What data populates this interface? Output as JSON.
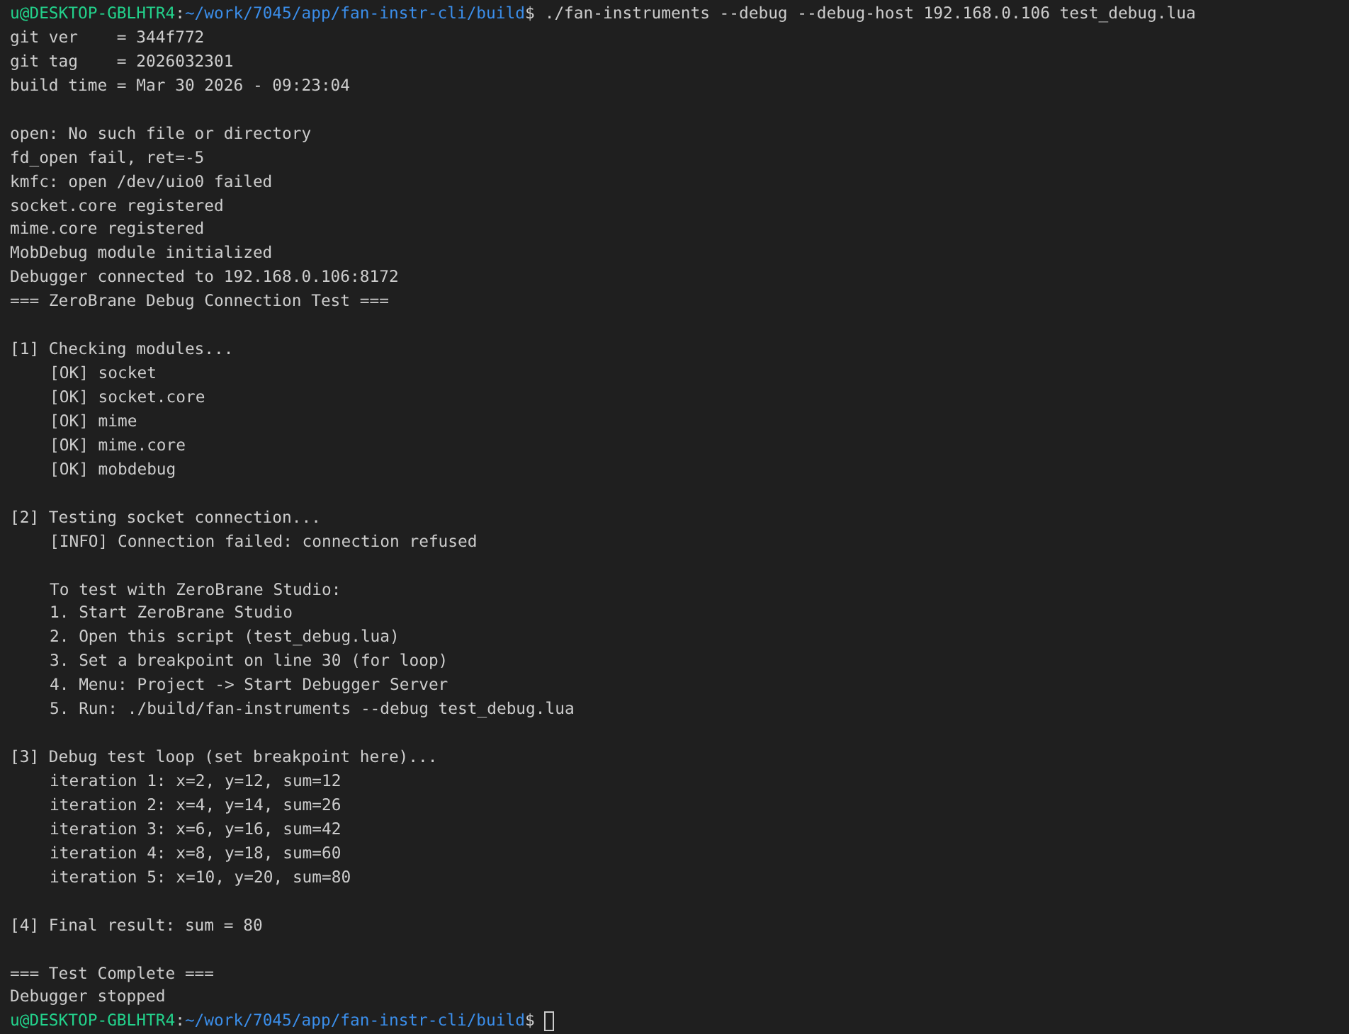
{
  "terminal": {
    "lines": [
      {
        "kind": "prompt",
        "user_host": "u@DESKTOP-GBLHTR4",
        "separator": ":",
        "path": "~/work/7045/app/fan-instr-cli/build",
        "symbol": "$",
        "command": "./fan-instruments --debug --debug-host 192.168.0.106 test_debug.lua",
        "cursor": false
      },
      {
        "kind": "output",
        "text": "git ver    = 344f772"
      },
      {
        "kind": "output",
        "text": "git tag    = 2026032301"
      },
      {
        "kind": "output",
        "text": "build time = Mar 30 2026 - 09:23:04"
      },
      {
        "kind": "blank"
      },
      {
        "kind": "output",
        "text": "open: No such file or directory"
      },
      {
        "kind": "output",
        "text": "fd_open fail, ret=-5"
      },
      {
        "kind": "output",
        "text": "kmfc: open /dev/uio0 failed"
      },
      {
        "kind": "output",
        "text": "socket.core registered"
      },
      {
        "kind": "output",
        "text": "mime.core registered"
      },
      {
        "kind": "output",
        "text": "MobDebug module initialized"
      },
      {
        "kind": "output",
        "text": "Debugger connected to 192.168.0.106:8172"
      },
      {
        "kind": "output",
        "text": "=== ZeroBrane Debug Connection Test ==="
      },
      {
        "kind": "blank"
      },
      {
        "kind": "output",
        "text": "[1] Checking modules...",
        "children": [
          {
            "kind": "output",
            "text": "[OK] socket"
          },
          {
            "kind": "output",
            "text": "[OK] socket.core"
          },
          {
            "kind": "output",
            "text": "[OK] mime"
          },
          {
            "kind": "output",
            "text": "[OK] mime.core"
          },
          {
            "kind": "output",
            "text": "[OK] mobdebug"
          }
        ]
      },
      {
        "kind": "blank"
      },
      {
        "kind": "output",
        "text": "[2] Testing socket connection...",
        "children": [
          {
            "kind": "output",
            "text": "[INFO] Connection failed: connection refused"
          },
          {
            "kind": "blank"
          },
          {
            "kind": "output",
            "text": "To test with ZeroBrane Studio:"
          },
          {
            "kind": "output",
            "text": "1. Start ZeroBrane Studio"
          },
          {
            "kind": "output",
            "text": "2. Open this script (test_debug.lua)"
          },
          {
            "kind": "output",
            "text": "3. Set a breakpoint on line 30 (for loop)"
          },
          {
            "kind": "output",
            "text": "4. Menu: Project -> Start Debugger Server"
          },
          {
            "kind": "output",
            "text": "5. Run: ./build/fan-instruments --debug test_debug.lua"
          }
        ]
      },
      {
        "kind": "blank"
      },
      {
        "kind": "output",
        "text": "[3] Debug test loop (set breakpoint here)...",
        "children": [
          {
            "kind": "output",
            "text": "iteration 1: x=2, y=12, sum=12"
          },
          {
            "kind": "output",
            "text": "iteration 2: x=4, y=14, sum=26"
          },
          {
            "kind": "output",
            "text": "iteration 3: x=6, y=16, sum=42"
          },
          {
            "kind": "output",
            "text": "iteration 4: x=8, y=18, sum=60"
          },
          {
            "kind": "output",
            "text": "iteration 5: x=10, y=20, sum=80"
          }
        ]
      },
      {
        "kind": "blank"
      },
      {
        "kind": "output",
        "text": "[4] Final result: sum = 80"
      },
      {
        "kind": "blank"
      },
      {
        "kind": "output",
        "text": "=== Test Complete ==="
      },
      {
        "kind": "output",
        "text": "Debugger stopped"
      },
      {
        "kind": "prompt",
        "user_host": "u@DESKTOP-GBLHTR4",
        "separator": ":",
        "path": "~/work/7045/app/fan-instr-cli/build",
        "symbol": "$",
        "cursor": true
      }
    ]
  }
}
